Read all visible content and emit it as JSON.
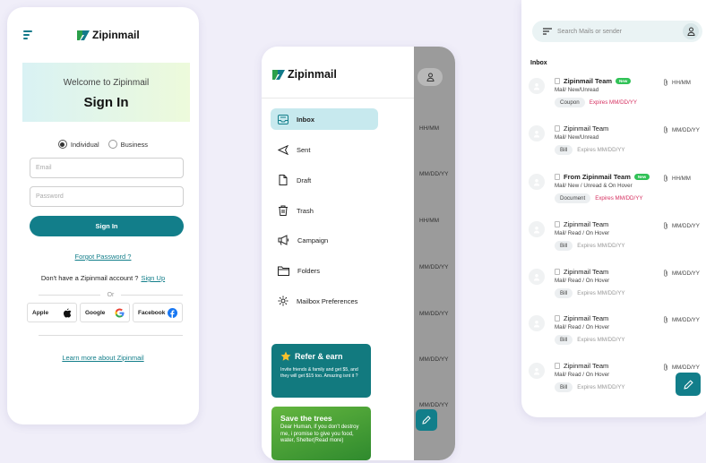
{
  "brand": {
    "name": "Zipinmail",
    "accent": "#127e8a"
  },
  "signin": {
    "welcome": "Welcome to  Zipinmail",
    "title": "Sign In",
    "options": [
      "Individual",
      "Business"
    ],
    "selected": "Individual",
    "email_placeholder": "Email",
    "password_placeholder": "Password",
    "button": "Sign In",
    "forgot": "Forgot Password ?",
    "no_account": "Don't have a Zipinmail account ?",
    "signup": "Sign Up",
    "or": "Or",
    "socials": [
      "Apple",
      "Google",
      "Facebook"
    ],
    "learn": "Learn more about Zipinmail"
  },
  "menu": {
    "items": [
      {
        "label": "Inbox",
        "icon": "inbox-icon",
        "active": true
      },
      {
        "label": "Sent",
        "icon": "send-icon"
      },
      {
        "label": "Draft",
        "icon": "draft-icon"
      },
      {
        "label": "Trash",
        "icon": "trash-icon"
      },
      {
        "label": "Campaign",
        "icon": "megaphone-icon"
      },
      {
        "label": "Folders",
        "icon": "folder-icon"
      },
      {
        "label": "Mailbox Preferences",
        "icon": "gear-icon"
      }
    ],
    "bg_times": [
      "HH/MM",
      "MM/DD/YY",
      "HH/MM",
      "MM/DD/YY",
      "MM/DD/YY",
      "MM/DD/YY",
      "MM/DD/YY"
    ],
    "refer": {
      "title": "Refer & earn",
      "desc": "Invite friends & family and get $5, and they will get $15 too. Amazing isnt it ?"
    },
    "save": {
      "title": "Save the trees",
      "desc": "Dear Human, if you don't destroy me, i promise to give you food, water, Shelter(Read more)"
    }
  },
  "inbox": {
    "search_placeholder": "Search Mails or sender",
    "title": "Inbox",
    "new_badge": "New",
    "rows": [
      {
        "sender": "Zipinmail Team",
        "status": "Mail/ New/Unread",
        "tag": "Coupon",
        "expires": "Expires MM/DD/YY",
        "time": "HH/MM",
        "bold": true,
        "new": true,
        "pink": true
      },
      {
        "sender": "Zipinmail Team",
        "status": "Mail/ New/Unread",
        "tag": "Bill",
        "expires": "Expires MM/DD/YY",
        "time": "MM/DD/YY",
        "bold": false,
        "new": false,
        "pink": false
      },
      {
        "sender": "From Zipinmail Team",
        "status": "Mail/ New / Unread & On Hover",
        "tag": "Document",
        "expires": "Expires MM/DD/YY",
        "time": "HH/MM",
        "bold": true,
        "new": true,
        "pink": true
      },
      {
        "sender": "Zipinmail Team",
        "status": "Mail/ Read / On Hover",
        "tag": "Bill",
        "expires": "Expires MM/DD/YY",
        "time": "MM/DD/YY",
        "bold": false,
        "new": false,
        "pink": false
      },
      {
        "sender": "Zipinmail Team",
        "status": "Mail/ Read / On Hover",
        "tag": "Bill",
        "expires": "Expires MM/DD/YY",
        "time": "MM/DD/YY",
        "bold": false,
        "new": false,
        "pink": false
      },
      {
        "sender": "Zipinmail Team",
        "status": "Mail/ Read / On Hover",
        "tag": "Bill",
        "expires": "Expires MM/DD/YY",
        "time": "MM/DD/YY",
        "bold": false,
        "new": false,
        "pink": false
      },
      {
        "sender": "Zipinmail Team",
        "status": "Mail/ Read / On Hover",
        "tag": "Bill",
        "expires": "Expires MM/DD/YY",
        "time": "MM/DD/YY",
        "bold": false,
        "new": false,
        "pink": false
      }
    ]
  }
}
